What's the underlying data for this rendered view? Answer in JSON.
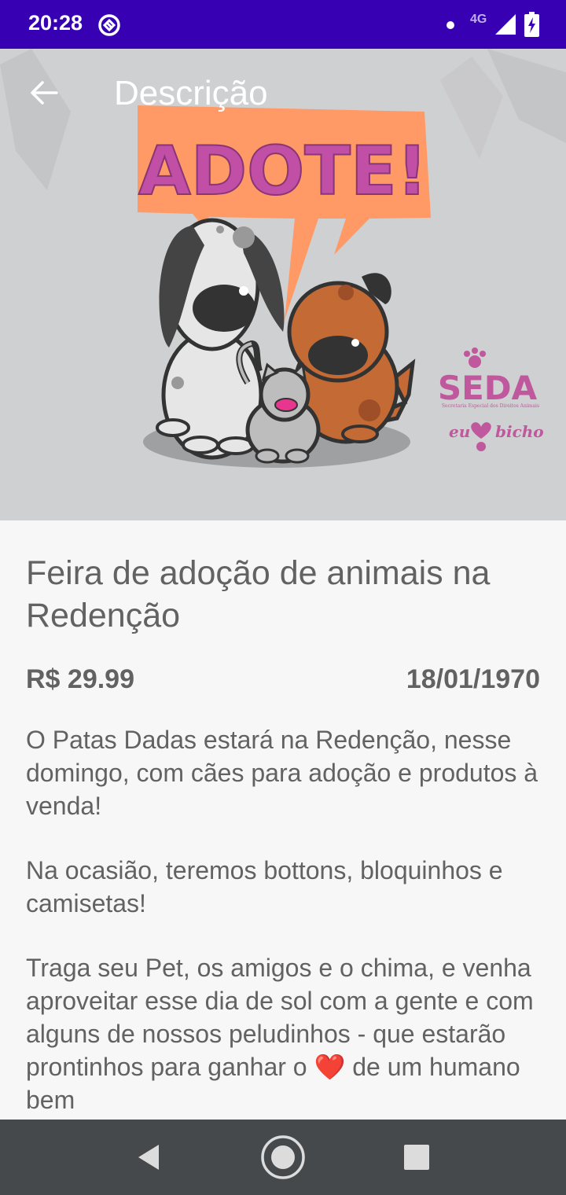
{
  "status_bar": {
    "time": "20:28",
    "network": "4G",
    "icons": [
      "app-notification-icon",
      "dot-icon",
      "signal-icon",
      "battery-icon"
    ]
  },
  "app_bar": {
    "title": "Descrição",
    "back_icon": "arrow-left-icon"
  },
  "hero_image": {
    "banner_text": "ADOTE!",
    "logo_text": "SEDA",
    "logo_subtext": "Secretaria Especial dos Direitos Animais",
    "tagline_left": "eu",
    "tagline_right": "bicho",
    "colors": {
      "banner": "#ff9966",
      "banner_text": "#c04fa5",
      "logo": "#c0589d",
      "dog_brown": "#c36a35"
    }
  },
  "event": {
    "title": "Feira de adoção de animais na Redenção",
    "price": "R$ 29.99",
    "date": "18/01/1970",
    "description": [
      "O Patas Dadas estará na Redenção, nesse domingo, com cães para adoção e produtos à venda!",
      "Na ocasião, teremos bottons, bloquinhos e camisetas!",
      "Traga seu Pet, os amigos e o chima, e venha aproveitar esse dia de sol com a gente e com alguns de nossos peludinhos - que estarão prontinhos para ganhar o ❤️ de um humano bem"
    ]
  },
  "nav_bar": {
    "icons": [
      "back-triangle-icon",
      "home-circle-icon",
      "recents-square-icon"
    ]
  },
  "colors": {
    "status_bar": "#3700b3",
    "text": "#626262",
    "background": "#f7f7f7",
    "nav_bar": "#46494c"
  }
}
